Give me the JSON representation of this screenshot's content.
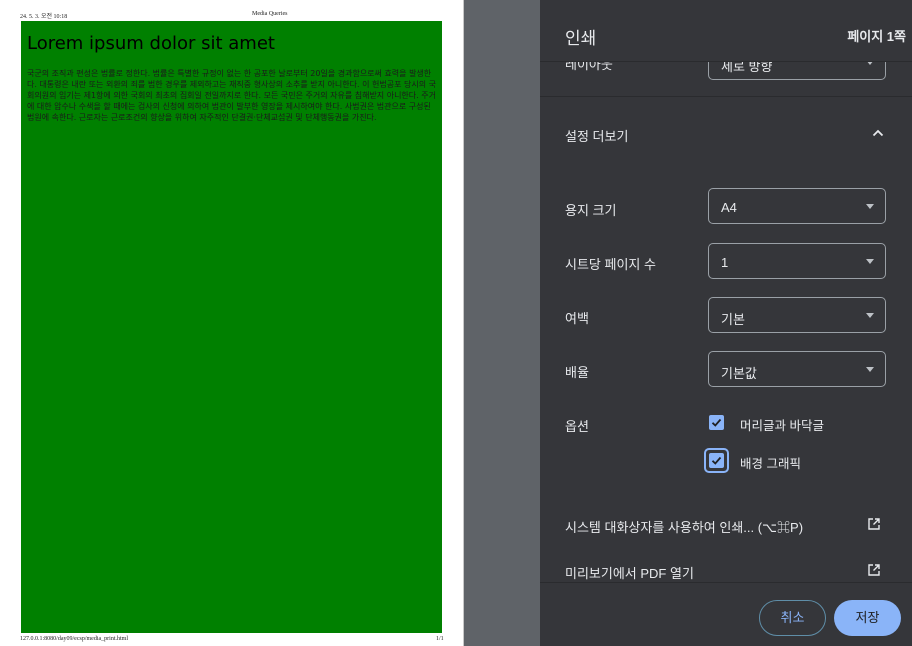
{
  "preview": {
    "header_date": "24. 5. 3. 오전 10:18",
    "header_title": "Media Queries",
    "footer_url": "127.0.0.1:8080/day09/ecsp/media_print.html",
    "footer_page": "1/1",
    "doc_heading": "Lorem ipsum dolor sit amet",
    "doc_body": "국군의 조직과 편성은 법률로 정한다. 법률은 특별한 규정이 없는 한 공포한 날로부터 20일을 경과함으로써 효력을 발생한다. 대통령은 내란 또는 외환의 죄를 범한 경우를 제외하고는 재직중 형사상의 소추를 받지 아니한다. 이 헌법공포 당시의 국회의원의 임기는 제1항에 의한 국회의 최초의 집회일 전일까지로 한다. 모든 국민은 주거의 자유를 침해받지 아니한다. 주거에 대한 압수나 수색을 할 때에는 검사의 신청에 의하여 법관이 발부한 영장을 제시하여야 한다. 사법권은 법관으로 구성된 법원에 속한다. 근로자는 근로조건의 향상을 위하여 자주적인 단결권·단체교섭권 및 단체행동권을 가진다.",
    "page_background_color": "#008000"
  },
  "panel": {
    "title": "인쇄",
    "page_count": "페이지 1쪽",
    "layout_label": "레이아웃",
    "layout_value": "세로 방향",
    "more_settings_label": "설정 더보기",
    "paper_size_label": "용지 크기",
    "paper_size_value": "A4",
    "pages_per_sheet_label": "시트당 페이지 수",
    "pages_per_sheet_value": "1",
    "margins_label": "여백",
    "margins_value": "기본",
    "scale_label": "배율",
    "scale_value": "기본값",
    "options_label": "옵션",
    "headers_footers_label": "머리글과 바닥글",
    "headers_footers_checked": true,
    "background_graphics_label": "배경 그래픽",
    "background_graphics_checked": true,
    "system_dialog_label": "시스템 대화상자를 사용하여 인쇄... (⌥⌘P)",
    "open_pdf_label": "미리보기에서 PDF 열기",
    "cancel_label": "취소",
    "save_label": "저장",
    "accent_color": "#8ab4f8",
    "panel_bg_color": "#35363a"
  }
}
